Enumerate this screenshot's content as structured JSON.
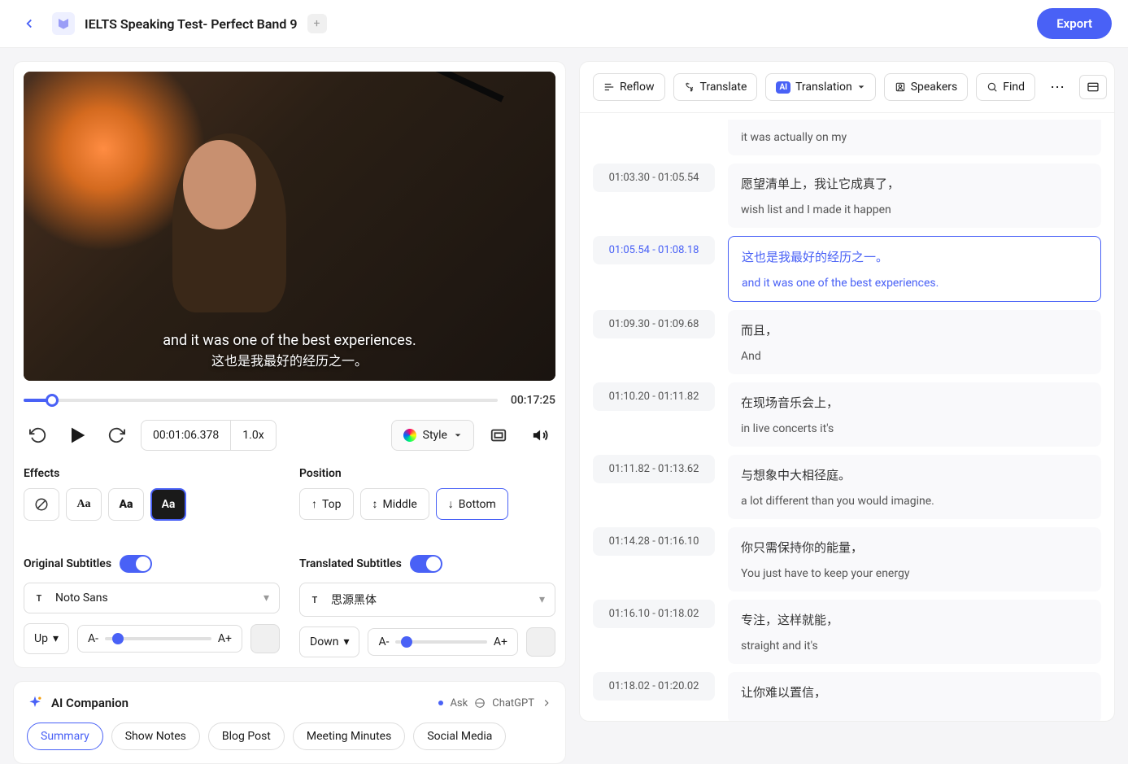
{
  "header": {
    "title": "IELTS Speaking Test- Perfect Band 9",
    "export_label": "Export"
  },
  "video": {
    "subtitle_en": "and it was one of the best experiences.",
    "subtitle_zh": "这也是我最好的经历之一。",
    "duration": "00:17:25",
    "current_time": "00:01:06.378",
    "speed": "1.0x",
    "style_label": "Style"
  },
  "effects": {
    "section_label": "Effects",
    "position_label": "Position",
    "top": "Top",
    "middle": "Middle",
    "bottom": "Bottom",
    "original_label": "Original Subtitles",
    "translated_label": "Translated Subtitles",
    "font_original": "Noto Sans",
    "font_translated": "思源黑体",
    "pos_up": "Up",
    "pos_down": "Down",
    "a_minus": "A-",
    "a_plus": "A+"
  },
  "companion": {
    "title": "AI Companion",
    "ask": "Ask",
    "chatgpt": "ChatGPT",
    "chips": [
      "Summary",
      "Show Notes",
      "Blog Post",
      "Meeting Minutes",
      "Social Media"
    ]
  },
  "toolbar": {
    "reflow": "Reflow",
    "translate": "Translate",
    "translation": "Translation",
    "speakers": "Speakers",
    "find": "Find"
  },
  "transcript": [
    {
      "start": "",
      "end": "",
      "zh": "",
      "en": "it was actually on my",
      "partial": true
    },
    {
      "start": "01:03.30",
      "end": "01:05.54",
      "zh": "愿望清单上，我让它成真了，",
      "en": "wish list and I made it happen"
    },
    {
      "start": "01:05.54",
      "end": "01:08.18",
      "zh": "这也是我最好的经历之一。",
      "en": "and it was one of the best experiences.",
      "active": true
    },
    {
      "start": "01:09.30",
      "end": "01:09.68",
      "zh": "而且，",
      "en": "And"
    },
    {
      "start": "01:10.20",
      "end": "01:11.82",
      "zh": "在现场音乐会上，",
      "en": "in live concerts it's"
    },
    {
      "start": "01:11.82",
      "end": "01:13.62",
      "zh": "与想象中大相径庭。",
      "en": "a lot different than you would imagine."
    },
    {
      "start": "01:14.28",
      "end": "01:16.10",
      "zh": "你只需保持你的能量，",
      "en": "You just have to keep your energy"
    },
    {
      "start": "01:16.10",
      "end": "01:18.02",
      "zh": "专注，这样就能，",
      "en": "straight and it's"
    },
    {
      "start": "01:18.02",
      "end": "01:20.02",
      "zh": "让你难以置信，",
      "en": ""
    }
  ]
}
